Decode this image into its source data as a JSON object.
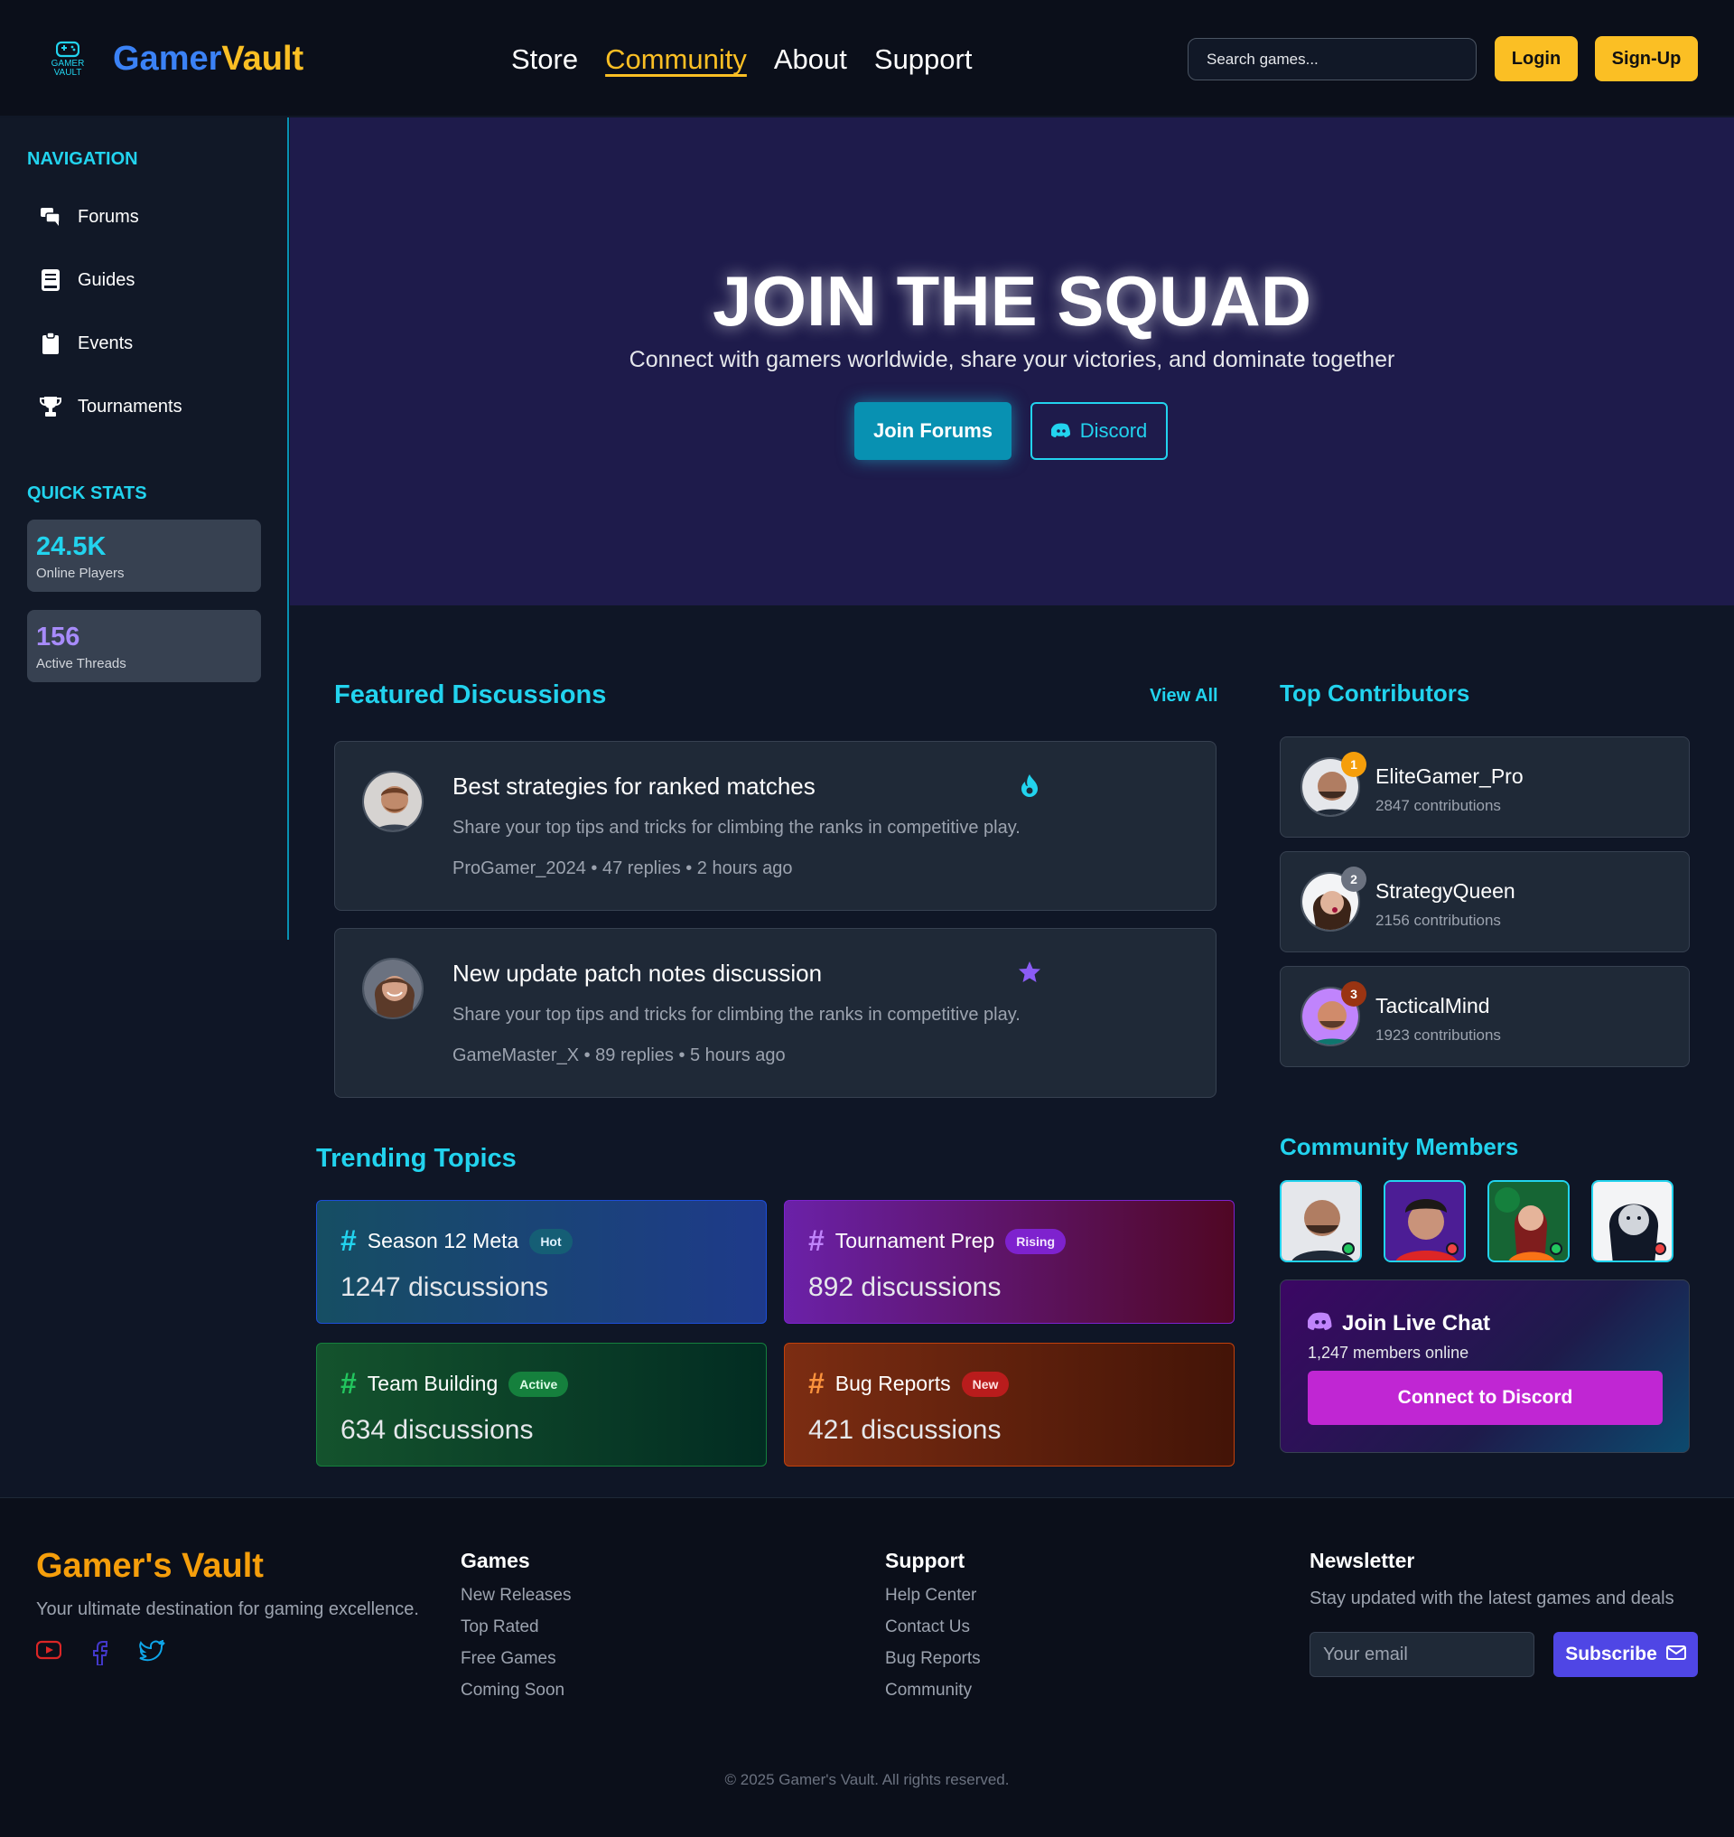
{
  "header": {
    "logo_mark_text": "GAMER VAULT",
    "brand_part1": "Gamer",
    "brand_part2": "Vault",
    "nav": [
      "Store",
      "Community",
      "About",
      "Support"
    ],
    "active_nav": "Community",
    "search_placeholder": "Search games...",
    "login_label": "Login",
    "signup_label": "Sign-Up"
  },
  "sidebar": {
    "nav_heading": "NAVIGATION",
    "items": [
      {
        "label": "Forums",
        "icon": "comments-icon"
      },
      {
        "label": "Guides",
        "icon": "book-icon"
      },
      {
        "label": "Events",
        "icon": "clipboard-icon"
      },
      {
        "label": "Tournaments",
        "icon": "trophy-icon"
      }
    ],
    "stats_heading": "QUICK STATS",
    "stats": [
      {
        "value": "24.5K",
        "label": "Online Players",
        "color": "#22d3ee"
      },
      {
        "value": "156",
        "label": "Active Threads",
        "color": "#a78bfa"
      }
    ]
  },
  "hero": {
    "title": "JOIN THE SQUAD",
    "subtitle": "Connect with gamers worldwide, share your victories, and dominate together",
    "join_label": "Join Forums",
    "discord_label": "Discord"
  },
  "featured": {
    "title": "Featured Discussions",
    "view_all": "View All",
    "items": [
      {
        "title": "Best strategies for ranked matches",
        "desc": "Share your top tips and tricks for climbing the ranks in competitive play.",
        "meta": "ProGamer_2024 • 47 replies • 2 hours ago",
        "badge": "fire-icon"
      },
      {
        "title": "New update patch notes discussion",
        "desc": "Share your top tips and tricks for climbing the ranks in competitive play.",
        "meta": "GameMaster_X • 89 replies • 5 hours ago",
        "badge": "star-icon"
      }
    ]
  },
  "trending": {
    "title": "Trending Topics",
    "items": [
      {
        "name": "Season 12 Meta",
        "tag": "Hot",
        "count": "1247 discussions"
      },
      {
        "name": "Tournament Prep",
        "tag": "Rising",
        "count": "892 discussions"
      },
      {
        "name": "Team Building",
        "tag": "Active",
        "count": "634 discussions"
      },
      {
        "name": "Bug Reports",
        "tag": "New",
        "count": "421 discussions"
      }
    ]
  },
  "contributors": {
    "title": "Top Contributors",
    "items": [
      {
        "rank": "1",
        "name": "EliteGamer_Pro",
        "count": "2847 contributions"
      },
      {
        "rank": "2",
        "name": "StrategyQueen",
        "count": "2156 contributions"
      },
      {
        "rank": "3",
        "name": "TacticalMind",
        "count": "1923 contributions"
      }
    ]
  },
  "members": {
    "title": "Community Members",
    "status": [
      "online",
      "offline",
      "online",
      "offline"
    ]
  },
  "chat": {
    "title": "Join Live Chat",
    "subtitle": "1,247 members online",
    "button": "Connect to Discord"
  },
  "footer": {
    "brand": "Gamer's Vault",
    "tagline": "Your ultimate destination for gaming excellence.",
    "social": [
      "youtube-icon",
      "facebook-icon",
      "twitter-icon"
    ],
    "games_heading": "Games",
    "games_links": [
      "New Releases",
      "Top Rated",
      "Free Games",
      "Coming Soon"
    ],
    "support_heading": "Support",
    "support_links": [
      "Help Center",
      "Contact Us",
      "Bug Reports",
      "Community"
    ],
    "newsletter_heading": "Newsletter",
    "newsletter_text": "Stay updated with the latest games and deals",
    "email_placeholder": "Your email",
    "subscribe_label": "Subscribe",
    "copyright": "© 2025 Gamer's Vault. All rights reserved."
  }
}
